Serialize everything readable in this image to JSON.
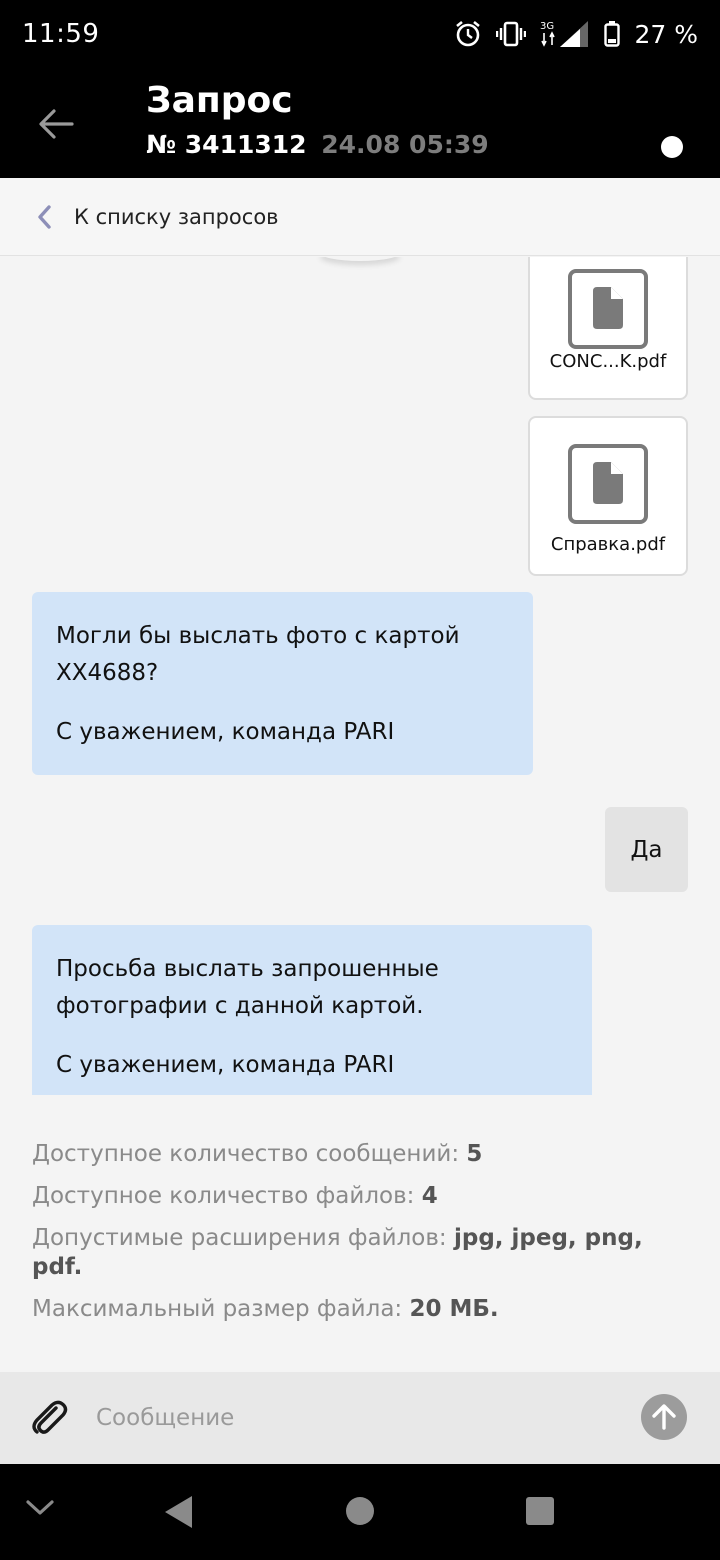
{
  "status_bar": {
    "time": "11:59",
    "network": "3G",
    "battery": "27 %"
  },
  "header": {
    "title": "Запрос",
    "number": "№ 3411312",
    "date": "24.08 05:39"
  },
  "list_link": {
    "label": "К списку запросов"
  },
  "attachments": [
    {
      "name": "CONC...K.pdf"
    },
    {
      "name": "Справка.pdf"
    }
  ],
  "messages": [
    {
      "direction": "incoming",
      "lines": [
        "Могли бы выслать фото с картой XX4688?",
        "С уважением, команда PARI"
      ]
    },
    {
      "direction": "outgoing",
      "text": "Да"
    },
    {
      "direction": "incoming",
      "lines": [
        "Просьба выслать запрошенные фотографии с данной картой.",
        "С уважением, команда PARI"
      ]
    }
  ],
  "info": {
    "messages_label": "Доступное количество сообщений:",
    "messages_value": "5",
    "files_label": "Доступное количество файлов:",
    "files_value": "4",
    "extensions_label": "Допустимые расширения файлов:",
    "extensions_value": "jpg, jpeg, png, pdf.",
    "max_size_label": "Максимальный размер файла:",
    "max_size_value": "20 МБ."
  },
  "composer": {
    "placeholder": "Сообщение"
  },
  "colors": {
    "incoming_bubble": "#d2e4f8",
    "outgoing_bubble": "#e3e3e3",
    "header_bg": "#000000"
  }
}
